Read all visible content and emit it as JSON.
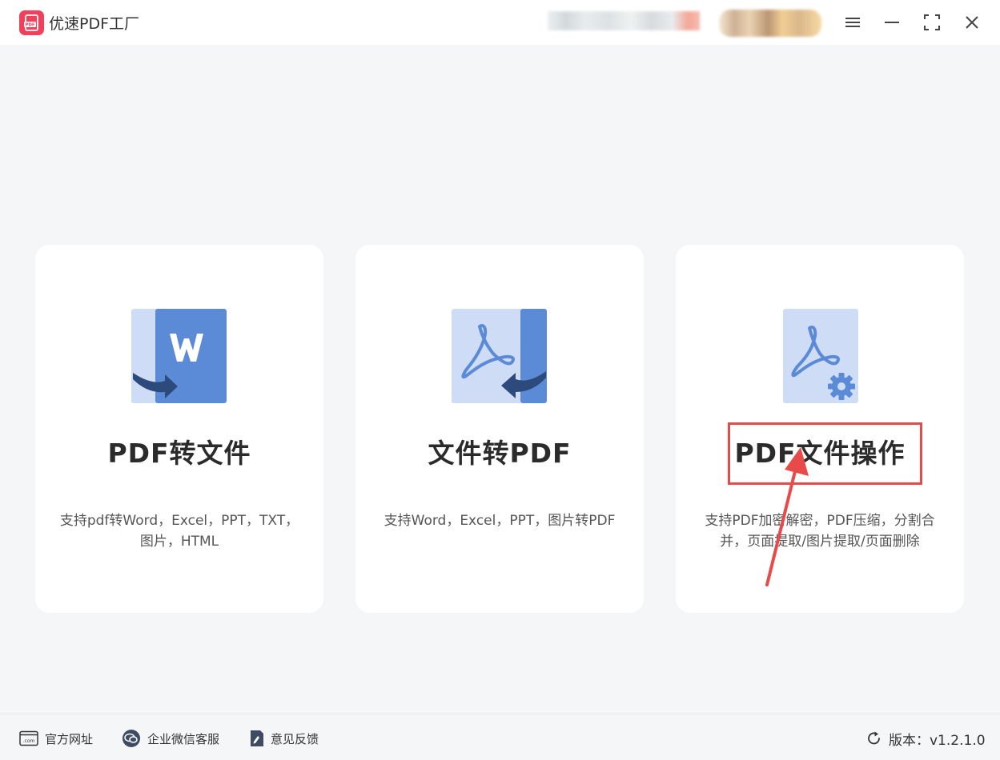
{
  "app": {
    "title": "优速PDF工厂",
    "logo_text": "PDF"
  },
  "titlebar": {
    "icons": [
      "menu-icon",
      "minimize-icon",
      "maximize-icon",
      "close-icon"
    ]
  },
  "cards": [
    {
      "title": "PDF转文件",
      "description": "支持pdf转Word，Excel，PPT，TXT，图片，HTML",
      "icon": "pdf-to-word-icon"
    },
    {
      "title": "文件转PDF",
      "description": "支持Word，Excel，PPT，图片转PDF",
      "icon": "file-to-pdf-icon"
    },
    {
      "title": "PDF文件操作",
      "description": "支持PDF加密解密，PDF压缩，分割合并，页面提取/图片提取/页面删除",
      "icon": "pdf-settings-icon"
    }
  ],
  "footer": {
    "website_label": "官方网址",
    "wechat_label": "企业微信客服",
    "feedback_label": "意见反馈",
    "version_label": "版本：v1.2.1.0"
  },
  "colors": {
    "brand": "#f23f5a",
    "icon_blue": "#5b8bd6",
    "icon_light": "#cfdcf5",
    "arrow_dark": "#2d4a7c",
    "annotation": "#e84a4a"
  }
}
